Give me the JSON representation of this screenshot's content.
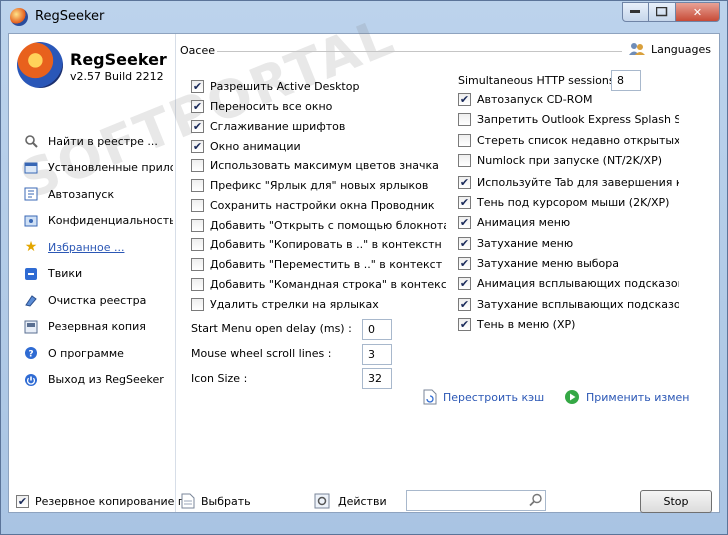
{
  "window": {
    "title": "RegSeeker"
  },
  "brand": {
    "name": "RegSeeker",
    "version": "v2.57 Build 2212",
    "watermark": "SOFTPORTAL"
  },
  "sidebar": {
    "items": [
      {
        "label": "Найти в реестре ...",
        "icon": "magnifier-icon"
      },
      {
        "label": "Установленные прило",
        "icon": "programs-icon"
      },
      {
        "label": "Автозапуск",
        "icon": "autostart-icon"
      },
      {
        "label": "Конфиденциальность",
        "icon": "privacy-icon"
      },
      {
        "label": "Избранное ...",
        "icon": "star-icon"
      },
      {
        "label": "Твики",
        "icon": "tweaks-icon"
      },
      {
        "label": "Очистка реестра",
        "icon": "registry-clean-icon"
      },
      {
        "label": "Резервная копия",
        "icon": "backup-icon"
      },
      {
        "label": "О программе",
        "icon": "help-icon"
      },
      {
        "label": "Выход из RegSeeker",
        "icon": "power-icon"
      }
    ]
  },
  "main": {
    "section_title": "Оасее",
    "languages": "Languages",
    "left_checks": [
      {
        "label": "Разрешить Active Desktop",
        "checked": true
      },
      {
        "label": "Переносить все окно",
        "checked": true
      },
      {
        "label": "Сглаживание шрифтов",
        "checked": true
      },
      {
        "label": "Окно анимации",
        "checked": true
      },
      {
        "label": "Использовать максимум цветов значка",
        "checked": false
      },
      {
        "label": "Префикс \"Ярлык для\" новых ярлыков",
        "checked": false
      },
      {
        "label": "Сохранить настройки окна Проводник",
        "checked": false
      },
      {
        "label": "Добавить \"Открыть с помощью блокнота\" в",
        "checked": false
      },
      {
        "label": "Добавить \"Копировать в ..\" в контекстн",
        "checked": false
      },
      {
        "label": "Добавить \"Переместить в ..\" в контекст",
        "checked": false
      },
      {
        "label": "Добавить \"Командная строка\" в контекстное",
        "checked": false
      },
      {
        "label": "Удалить стрелки на ярлыках",
        "checked": false
      }
    ],
    "fields": [
      {
        "label": "Start Menu open delay (ms) :",
        "value": "0"
      },
      {
        "label": "Mouse wheel scroll lines :",
        "value": "3"
      },
      {
        "label": "Icon Size :",
        "value": "32"
      }
    ],
    "http_sessions": {
      "label": "Simultaneous HTTP sessions :",
      "value": "8"
    },
    "right_checks": [
      {
        "label": "Автозапуск CD-ROM",
        "checked": true
      },
      {
        "label": "Запретить Outlook Express Splash Scre",
        "checked": false
      },
      {
        "label": "Стереть список недавно открытых до",
        "checked": false
      },
      {
        "label": "Numlock при запуске (NT/2K/XP)",
        "checked": false
      },
      {
        "label": "Используйте Tab для завершения ком",
        "checked": true
      },
      {
        "label": "Тень под курсором мыши (2K/XP)",
        "checked": true
      },
      {
        "label": "Анимация меню",
        "checked": true
      },
      {
        "label": "Затухание меню",
        "checked": true
      },
      {
        "label": "Затухание меню выбора",
        "checked": true
      },
      {
        "label": "Анимация всплывающих подсказок",
        "checked": true
      },
      {
        "label": "Затухание всплывающих подсказок",
        "checked": true
      },
      {
        "label": "Тень в меню (XP)",
        "checked": true
      }
    ],
    "rebuild_cache": "Перестроить кэш",
    "apply_changes": "Применить измен"
  },
  "bottombar": {
    "backup_label": "Резервное копирование п",
    "backup_checked": true,
    "select_label": "Выбрать",
    "actions_label": "Действи",
    "search_value": "",
    "stop_label": "Stop"
  }
}
